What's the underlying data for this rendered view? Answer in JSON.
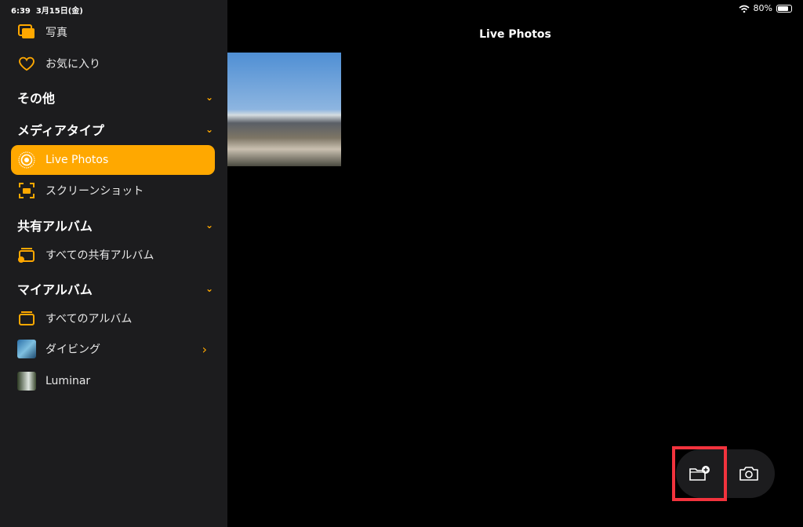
{
  "status": {
    "time": "6:39",
    "date": "3月15日(金)",
    "battery": "80%",
    "battery_level": 0.8
  },
  "sidebar": {
    "items": [
      {
        "label": "写真",
        "icon": "photos-icon"
      },
      {
        "label": "お気に入り",
        "icon": "heart-icon"
      }
    ],
    "sections": [
      {
        "label": "その他"
      },
      {
        "label": "メディアタイプ"
      },
      {
        "label": "共有アルバム"
      },
      {
        "label": "マイアルバム"
      }
    ],
    "media": [
      {
        "label": "Live Photos",
        "selected": true
      },
      {
        "label": "スクリーンショット"
      }
    ],
    "shared": [
      {
        "label": "すべての共有アルバム"
      }
    ],
    "albums": [
      {
        "label": "すべてのアルバム"
      },
      {
        "label": "ダイビング"
      },
      {
        "label": "Luminar"
      }
    ]
  },
  "main": {
    "title": "Live Photos"
  },
  "toolbar": {
    "buttons": [
      "new-folder-icon",
      "camera-icon"
    ]
  },
  "colors": {
    "accent": "#ffa800",
    "highlight": "#f2333d",
    "sidebar": "#1c1c1e"
  }
}
